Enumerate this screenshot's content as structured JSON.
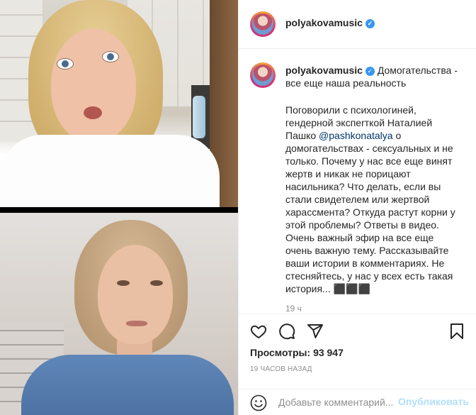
{
  "post": {
    "username": "polyakovamusic",
    "verified_icon": "verified-badge-icon",
    "caption_title": "Домогательства - все еще наша реальность",
    "caption_before_mention": "Поговорили с психологиней, гендерной экспerткой Наталией Пашко ",
    "mention": "@pashkonatalya",
    "caption_after_mention": " о домогательствах - сексуальных и не только. Почему у нас все еще винят жертв и никак не порицают насильника? Что делать, если вы стали свидетелем или жертвой харассмента? Откуда растут корни у этой проблемы? Ответы в видео. Очень важный эфир на все еще очень важную тему. Рассказывайте ваши истории в комментариях. Не стесняйтесь, у нас у всех есть такая история... ",
    "caption_emoji": "⬛⬛⬛",
    "caption_time": "19 ч",
    "views_label": "Просмотры:",
    "views_count": "93 947",
    "posted_ago": "19 ЧАСОВ НАЗАД"
  },
  "actions": {
    "like_icon": "heart-icon",
    "comment_icon": "comment-icon",
    "share_icon": "share-icon",
    "save_icon": "bookmark-icon"
  },
  "comment_box": {
    "emoji_icon": "smiley-icon",
    "placeholder": "Добавьте комментарий...",
    "publish_label": "Опубликовать"
  },
  "colors": {
    "link": "#00376b",
    "verified": "#3897f0",
    "publish_disabled": "#b2dffc",
    "muted": "#8e8e8e"
  }
}
